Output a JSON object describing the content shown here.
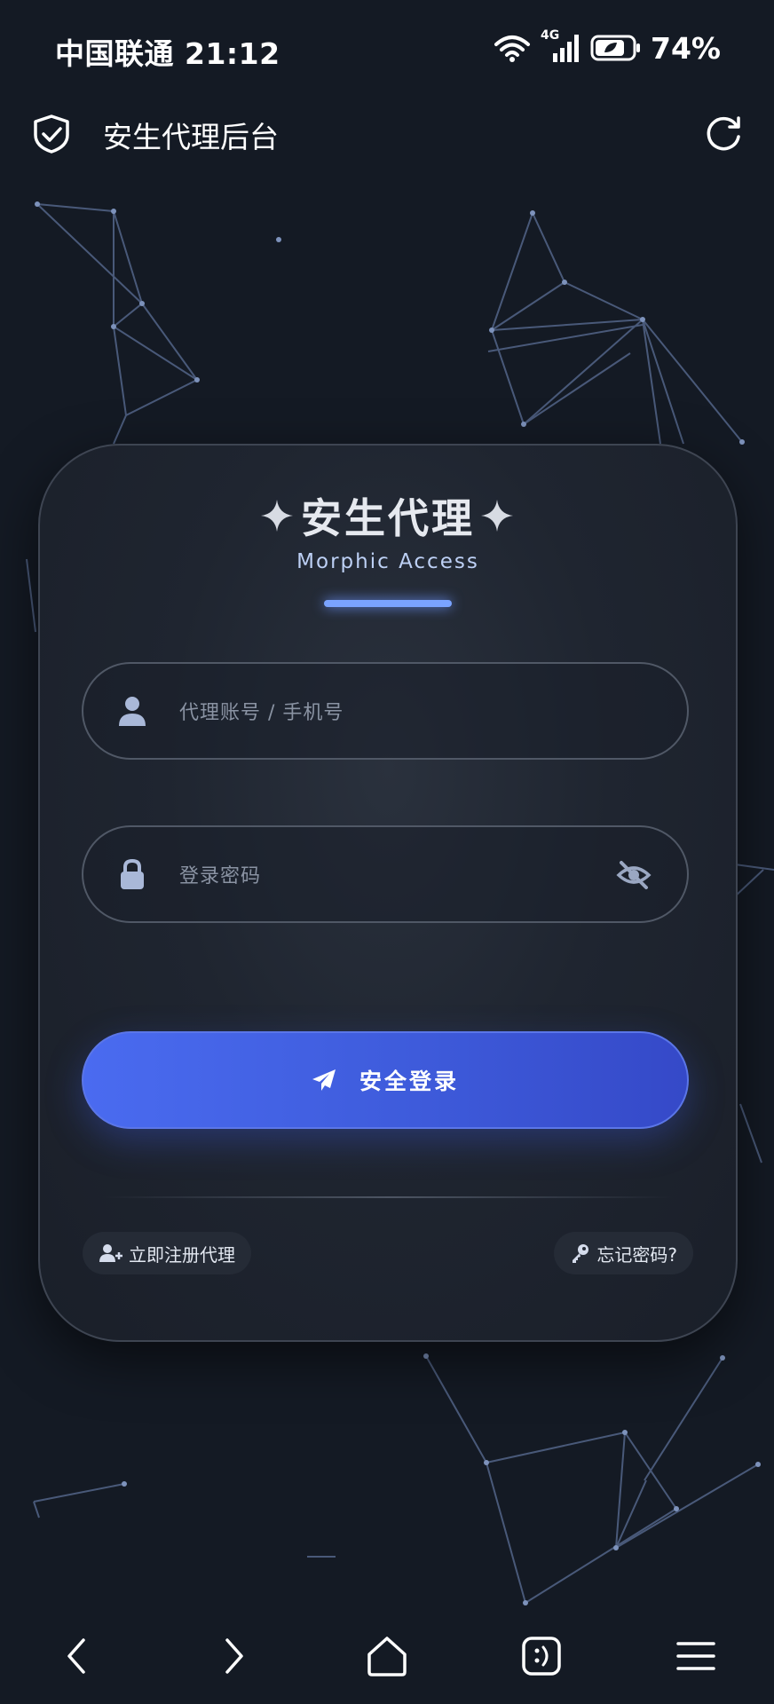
{
  "status_bar": {
    "carrier_time": "中国联通 21:12",
    "network": "4G",
    "battery": "74%"
  },
  "app_bar": {
    "title": "安生代理后台",
    "shield_icon": "shield-check-icon",
    "refresh_icon": "refresh-icon"
  },
  "login_card": {
    "title": "安生代理",
    "subtitle": "Morphic Access",
    "username": {
      "placeholder": "代理账号 / 手机号",
      "value": "",
      "icon": "user-icon"
    },
    "password": {
      "placeholder": "登录密码",
      "value": "",
      "icon": "lock-icon",
      "toggle_icon": "eye-off-icon"
    },
    "login_button": {
      "label": "安全登录",
      "icon": "send-icon"
    },
    "register_link": "立即注册代理",
    "forgot_link": "忘记密码?"
  },
  "nav_bar": {
    "items": [
      "back-icon",
      "forward-icon",
      "home-icon",
      "tabs-icon",
      "menu-icon"
    ]
  },
  "colors": {
    "background": "#141a24",
    "accent": "#4a6bf0",
    "accent_glow": "#7aa3ff"
  }
}
